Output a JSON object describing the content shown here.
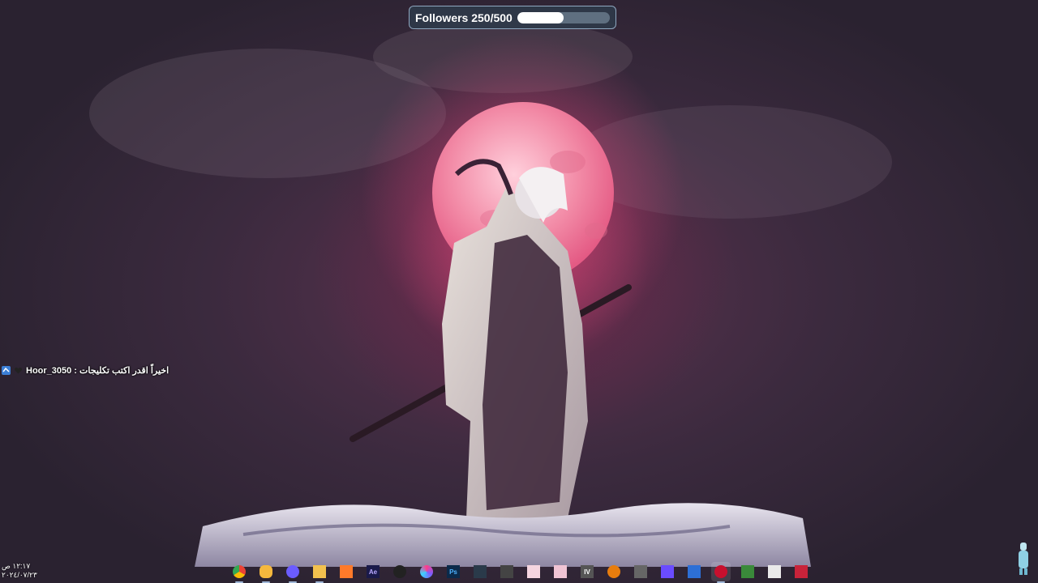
{
  "followers": {
    "label": "Followers 250/500",
    "current": 250,
    "goal": 500,
    "progress": 0.5
  },
  "chat": {
    "message": "Hoor_3050 : اخيراً اقدر اكتب تكليجات"
  },
  "clock": {
    "time": "١٢:١٧ ص",
    "date": "٢٠٢٤/٠٧/٢٣"
  },
  "taskbar": {
    "apps": [
      {
        "icon": "chrome-icon",
        "label": ""
      },
      {
        "icon": "discord-icon",
        "label": ""
      },
      {
        "icon": "app-icon",
        "label": ""
      },
      {
        "icon": "file-explorer-icon",
        "label": ""
      },
      {
        "icon": "affinity-icon",
        "label": ""
      },
      {
        "icon": "after-effects-icon",
        "label": "Ae"
      },
      {
        "icon": "obs-icon",
        "label": ""
      },
      {
        "icon": "color-app-icon",
        "label": ""
      },
      {
        "icon": "photoshop-icon",
        "label": "Ps"
      },
      {
        "icon": "davinci-icon",
        "label": ""
      },
      {
        "icon": "wrench-icon",
        "label": ""
      },
      {
        "icon": "anime-app-icon",
        "label": ""
      },
      {
        "icon": "anime-app-2-icon",
        "label": ""
      },
      {
        "icon": "iv-icon",
        "label": "IV"
      },
      {
        "icon": "blender-icon",
        "label": ""
      },
      {
        "icon": "gamepad-icon",
        "label": ""
      },
      {
        "icon": "play-icon",
        "label": ""
      },
      {
        "icon": "remote-desktop-icon",
        "label": ""
      },
      {
        "icon": "davinci-red-icon",
        "label": ""
      },
      {
        "icon": "notebook-icon",
        "label": ""
      },
      {
        "icon": "store-icon",
        "label": ""
      },
      {
        "icon": "video-editor-icon",
        "label": ""
      }
    ]
  }
}
